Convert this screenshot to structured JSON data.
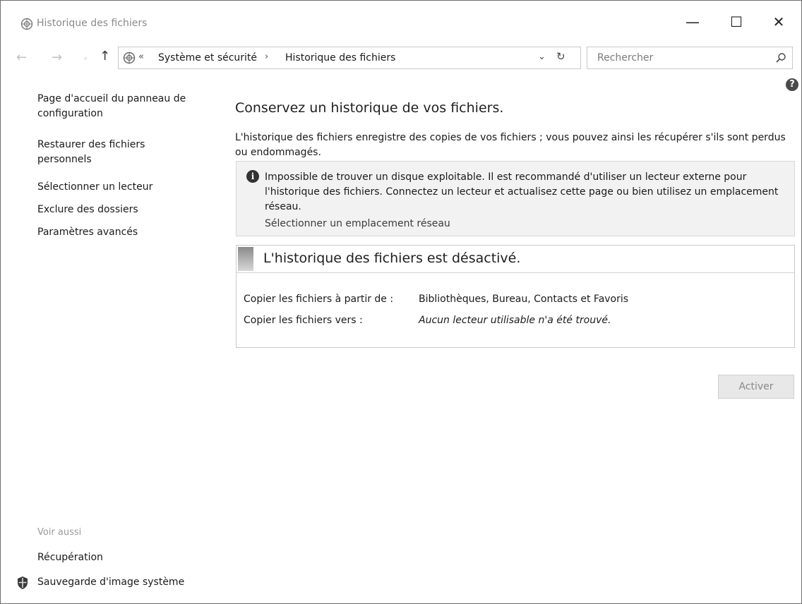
{
  "window": {
    "title": "Historique des fichiers",
    "controls": {
      "minimize": "—",
      "maximize": "☐",
      "close": "✕"
    }
  },
  "navigation": {
    "back": "←",
    "forward": "→",
    "recent": "⌄",
    "up": "↑",
    "address": {
      "chevron": "«",
      "crumbs": [
        "Système et sécurité",
        "Historique des fichiers"
      ],
      "separator": "›",
      "dropdown": "⌄",
      "refresh": "↻"
    },
    "search": {
      "placeholder": "Rechercher"
    }
  },
  "help": {
    "label": "?"
  },
  "sidebar": {
    "home": "Page d'accueil du panneau de configuration",
    "links": [
      "Restaurer des fichiers personnels",
      "Sélectionner un lecteur",
      "Exclure des dossiers",
      "Paramètres avancés"
    ],
    "see_also_heading": "Voir aussi",
    "see_also": [
      "Récupération",
      "Sauvegarde d'image système"
    ]
  },
  "main": {
    "heading": "Conservez un historique de vos fichiers.",
    "description": "L'historique des fichiers enregistre des copies de vos fichiers ; vous pouvez ainsi les récupérer s'ils sont perdus ou endommagés.",
    "warning": {
      "icon": "i",
      "text": "Impossible de trouver un disque exploitable. Il est recommandé d'utiliser un lecteur externe pour l'historique des fichiers. Connectez un lecteur et actualisez cette page ou bien utilisez un emplacement réseau.",
      "link": "Sélectionner un emplacement réseau"
    },
    "status": {
      "title": "L'historique des fichiers est désactivé.",
      "rows": [
        {
          "label": "Copier les fichiers à partir de :",
          "value": "Bibliothèques, Bureau, Contacts et Favoris"
        },
        {
          "label": "Copier les fichiers vers :",
          "value": "Aucun lecteur utilisable n'a été trouvé."
        }
      ]
    },
    "activate_button": "Activer"
  },
  "colors": {
    "border": "#c9c9c9",
    "warning_background": "#f2f2f2",
    "disabled_text": "#8a8a8a"
  }
}
